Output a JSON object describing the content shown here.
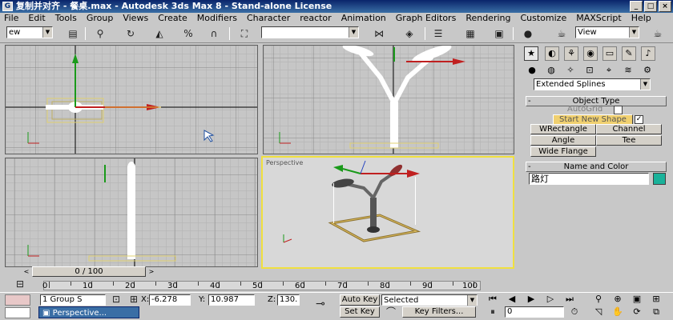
{
  "window": {
    "app_icon": "3ds-max-icon",
    "title": "复制并对齐 - 餐桌.max - Autodesk 3ds Max 8  - Stand-alone License",
    "minimize_label": "_",
    "maximize_label": "□",
    "close_label": "×"
  },
  "menu": [
    "File",
    "Edit",
    "Tools",
    "Group",
    "Views",
    "Create",
    "Modifiers",
    "Character",
    "reactor",
    "Animation",
    "Graph Editors",
    "Rendering",
    "Customize",
    "MAXScript",
    "Help"
  ],
  "toolbar": {
    "selection_filter": "ew",
    "named_selection": "",
    "reference_coord": "View",
    "axis_label": "x",
    "scale_label": "3"
  },
  "viewports": {
    "perspective_label": "Perspective"
  },
  "command_panel": {
    "category": "Extended Splines",
    "object_type_title": "Object Type",
    "object_type_pm": "-",
    "autogrid_label": "AutoGrid",
    "start_new_shape_label": "Start New Shape",
    "start_new_shape_check": "✓",
    "buttons": [
      "WRectangle",
      "Channel",
      "Angle",
      "Tee",
      "Wide Flange"
    ],
    "name_color_title": "Name and Color",
    "name_color_pm": "-",
    "object_name": "路灯",
    "object_color": "#1ab29a"
  },
  "time_slider": {
    "label": "0 / 100",
    "prev_label": "<",
    "next_label": ">"
  },
  "ruler": {
    "ticks": [
      "0",
      "10",
      "20",
      "30",
      "40",
      "50",
      "60",
      "70",
      "80",
      "90",
      "100"
    ]
  },
  "status": {
    "selection_text": "1 Group S",
    "taskbar_item": "Perspective...",
    "x_label": "X:",
    "x_value": "-6.278",
    "y_label": "Y:",
    "y_value": "10.987",
    "z_label": "Z:",
    "z_value": "130.",
    "auto_key_label": "Auto Key",
    "set_key_label": "Set Key",
    "key_mode_value": "Selected",
    "key_filters_label": "Key Filters...",
    "frame_value": "0"
  }
}
